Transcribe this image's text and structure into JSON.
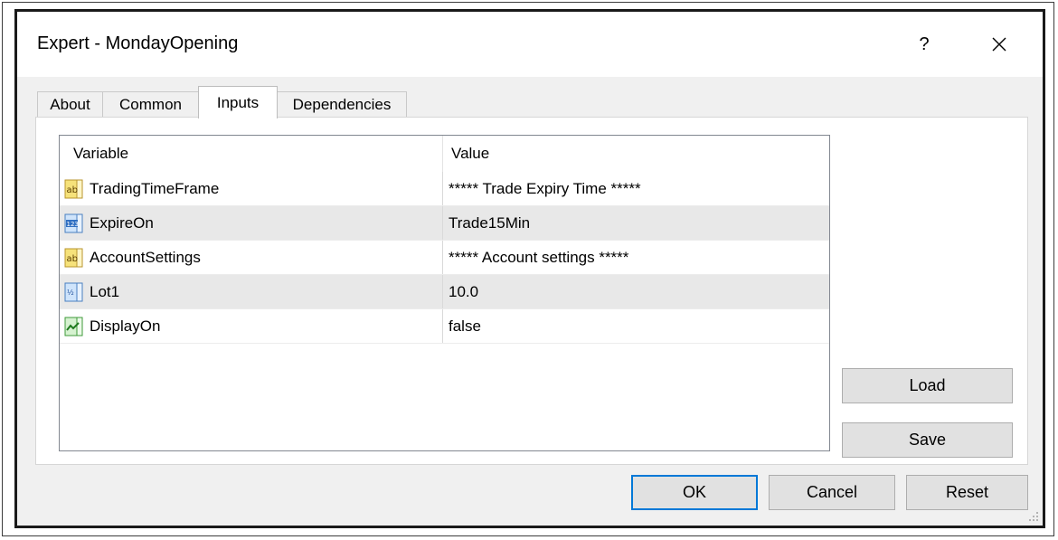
{
  "window": {
    "title": "Expert - MondayOpening",
    "help_label": "?",
    "close_icon": "close-icon"
  },
  "tabs": [
    {
      "label": "About",
      "active": false
    },
    {
      "label": "Common",
      "active": false
    },
    {
      "label": "Inputs",
      "active": true
    },
    {
      "label": "Dependencies",
      "active": false
    }
  ],
  "inputs_table": {
    "headers": {
      "variable": "Variable",
      "value": "Value"
    },
    "rows": [
      {
        "icon": "string-ab-icon",
        "variable": "TradingTimeFrame",
        "value": "***** Trade Expiry Time *****"
      },
      {
        "icon": "enum-123-icon",
        "variable": "ExpireOn",
        "value": "Trade15Min"
      },
      {
        "icon": "string-ab-icon",
        "variable": "AccountSettings",
        "value": "***** Account settings *****"
      },
      {
        "icon": "double-fraction-icon",
        "variable": "Lot1",
        "value": "10.0"
      },
      {
        "icon": "bool-chart-icon",
        "variable": "DisplayOn",
        "value": "false"
      }
    ]
  },
  "side_buttons": {
    "load": "Load",
    "save": "Save"
  },
  "footer_buttons": {
    "ok": "OK",
    "cancel": "Cancel",
    "reset": "Reset"
  },
  "colors": {
    "default_button_border": "#0078d7",
    "alt_row": "#e8e8e8"
  }
}
